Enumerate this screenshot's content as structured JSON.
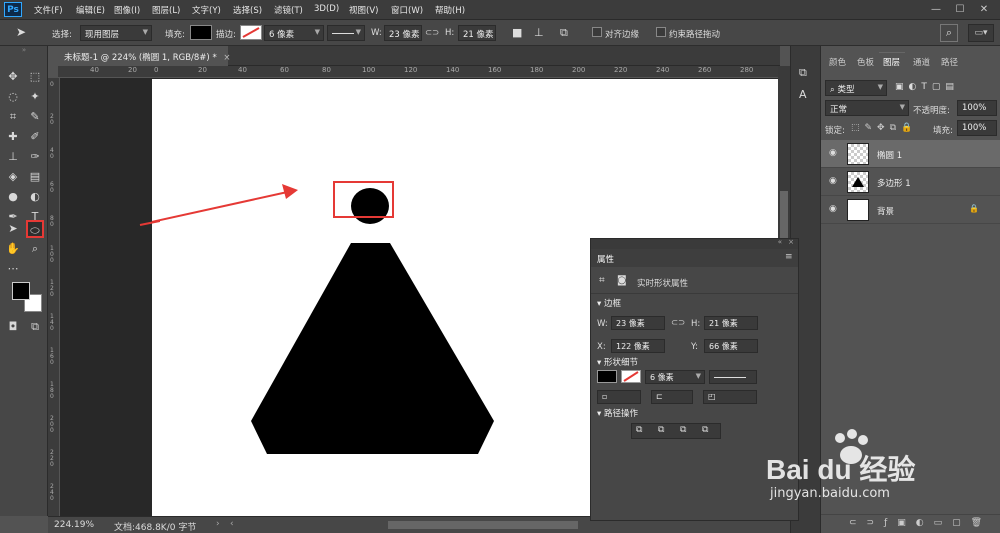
{
  "app": {
    "logo": "Ps"
  },
  "menu": [
    "文件(F)",
    "编辑(E)",
    "图像(I)",
    "图层(L)",
    "文字(Y)",
    "选择(S)",
    "滤镜(T)",
    "3D(D)",
    "视图(V)",
    "窗口(W)",
    "帮助(H)"
  ],
  "window_controls": [
    "—",
    "☐",
    "✕"
  ],
  "options": {
    "select_label": "选择:",
    "select_value": "现用图层",
    "fill_label": "填充:",
    "stroke_label": "描边:",
    "stroke_width": "6 像素",
    "w_label": "W:",
    "w_value": "23 像素",
    "link_symbol": "⊂⊃",
    "h_label": "H:",
    "h_value": "21 像素",
    "align_edges": "对齐边缘",
    "constrain_path": "约束路径拖动"
  },
  "document": {
    "tab_title": "未标题-1 @ 224% (椭圆 1, RGB/8#) *",
    "close": "×",
    "zoom": "224.19%",
    "doc_info": "文档:468.8K/0 字节"
  },
  "ruler_top": [
    "40",
    "20",
    "0",
    "20",
    "40",
    "60",
    "80",
    "100",
    "120",
    "140",
    "160",
    "180",
    "200",
    "220",
    "240",
    "260",
    "280"
  ],
  "ruler_left": [
    "0",
    "2 0",
    "4 0",
    "6 0",
    "8 0",
    "1 0 0",
    "1 2 0",
    "1 4 0",
    "1 6 0",
    "1 8 0",
    "2 0 0",
    "2 2 0",
    "2 4 0"
  ],
  "panel_tabs": [
    "颜色",
    "色板",
    "图层",
    "通道",
    "路径"
  ],
  "layers_panel": {
    "filter_kind": "类型",
    "blend_mode": "正常",
    "opacity_label": "不透明度:",
    "opacity_value": "100%",
    "lock_label": "锁定:",
    "fill_label": "填充:",
    "fill_value": "100%",
    "layers": [
      {
        "name": "椭圆 1",
        "selected": true
      },
      {
        "name": "多边形 1",
        "selected": false
      },
      {
        "name": "背景",
        "selected": false
      }
    ]
  },
  "properties": {
    "tab": "属性",
    "title": "实时形状属性",
    "section_border": "边框",
    "w_label": "W:",
    "w_value": "23 像素",
    "h_label": "H:",
    "h_value": "21 像素",
    "x_label": "X:",
    "x_value": "122 像素",
    "y_label": "Y:",
    "y_value": "66 像素",
    "section_shape": "形状细节",
    "stroke_width": "6 像素",
    "section_path": "路径操作"
  },
  "watermark": {
    "brand": "Bai du 经验",
    "url": "jingyan.baidu.com"
  },
  "colors": {
    "accent_red": "#e53935",
    "shape": "#000000",
    "canvas": "#ffffff",
    "ps_blue": "#31a8ff"
  }
}
